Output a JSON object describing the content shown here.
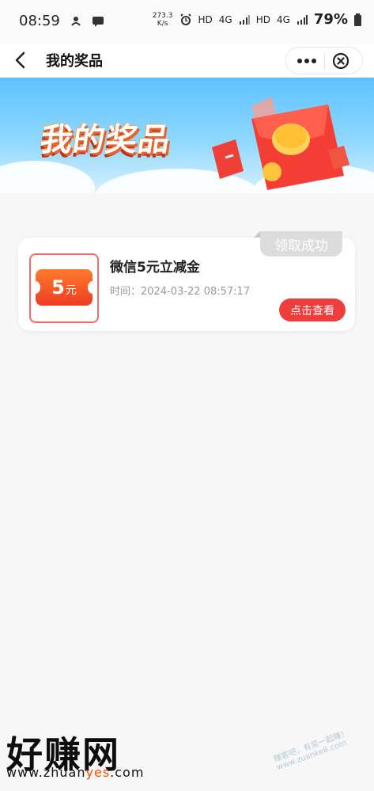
{
  "status_bar": {
    "time": "08:59",
    "network_speed": "273.3",
    "network_unit": "K/s",
    "hd1": "HD",
    "net1": "4G",
    "hd2": "HD",
    "net2": "4G",
    "battery": "79%"
  },
  "nav": {
    "title": "我的奖品"
  },
  "banner": {
    "title": "我的奖品"
  },
  "prize": {
    "status": "领取成功",
    "coupon_value": "5",
    "coupon_unit": "元",
    "title": "微信5元立减金",
    "time_label": "时间：",
    "time": "2024-03-22 08:57:17",
    "button": "点击查看"
  },
  "watermark": {
    "logo": "好赚网",
    "url_prefix": "www.zhuan",
    "url_highlight": "yes",
    "url_suffix": ".com",
    "faint_text": "赚客吧，有奖一起赚！ www.zuanke8.com"
  }
}
